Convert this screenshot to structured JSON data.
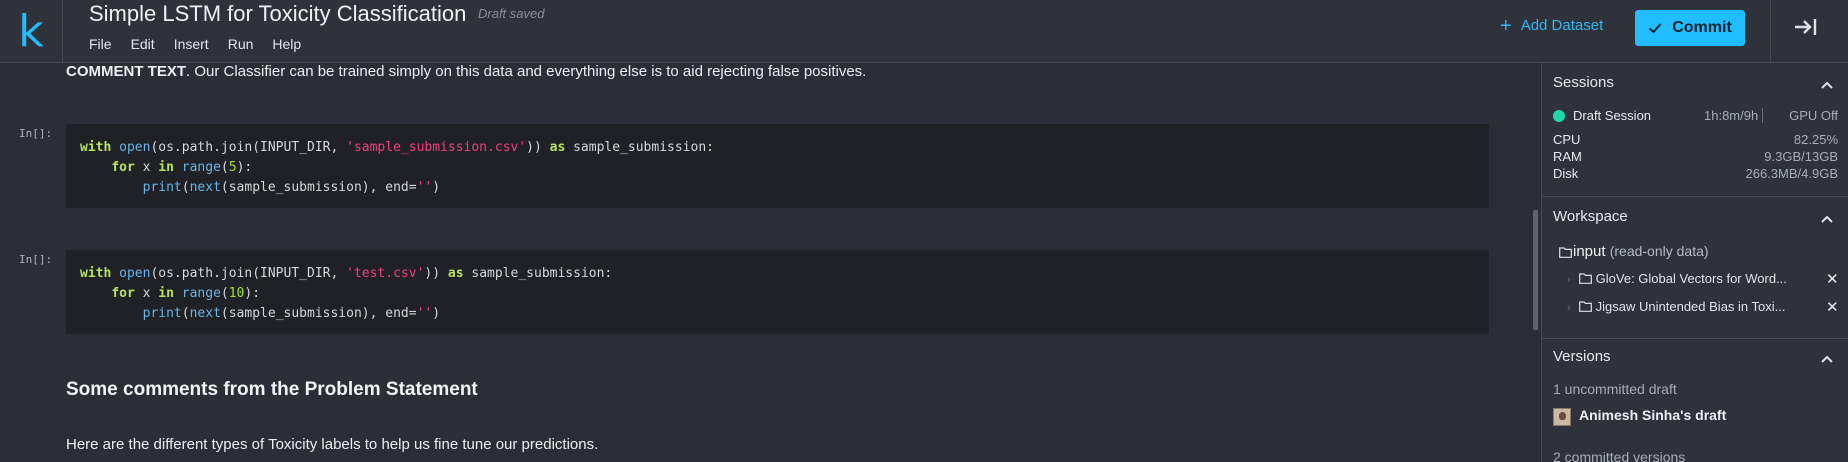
{
  "app": {
    "logo_letter": "k",
    "title": "Simple LSTM for Toxicity Classification",
    "save_status": "Draft saved"
  },
  "menu": [
    "File",
    "Edit",
    "Insert",
    "Run",
    "Help"
  ],
  "toolbar": {
    "add_dataset_label": "Add Dataset",
    "commit_label": "Commit"
  },
  "notebook": {
    "intro_bold": "COMMENT TEXT",
    "intro_rest": ". Our Classifier can be trained simply on this data and everything else is to aid rejecting false positives.",
    "cells": [
      {
        "prompt": "In[]:",
        "file": "'sample_submission.csv'",
        "range_arg": "5"
      },
      {
        "prompt": "In[]:",
        "file": "'test.csv'",
        "range_arg": "10"
      }
    ],
    "section_heading": "Some comments from the Problem Statement",
    "paragraph": "Here are the different types of Toxicity labels to help us fine tune our predictions."
  },
  "panel": {
    "sessions": {
      "heading": "Sessions",
      "session_name": "Draft Session",
      "elapsed": "1h:8m/9h",
      "gpu": "GPU Off",
      "stats": [
        {
          "label": "CPU",
          "value": "82.25%"
        },
        {
          "label": "RAM",
          "value": "9.3GB/13GB"
        },
        {
          "label": "Disk",
          "value": "266.3MB/4.9GB"
        }
      ]
    },
    "workspace": {
      "heading": "Workspace",
      "root_label": "input",
      "root_note": "(read-only data)",
      "items": [
        "GloVe: Global Vectors for Word...",
        "Jigsaw Unintended Bias in Toxi..."
      ]
    },
    "versions": {
      "heading": "Versions",
      "uncommitted": "1 uncommitted draft",
      "draft_owner": "Animesh Sinha's draft",
      "committed": "2 committed versions"
    }
  },
  "colors": {
    "accent": "#20beff",
    "session_dot": "#1fd8a8"
  }
}
